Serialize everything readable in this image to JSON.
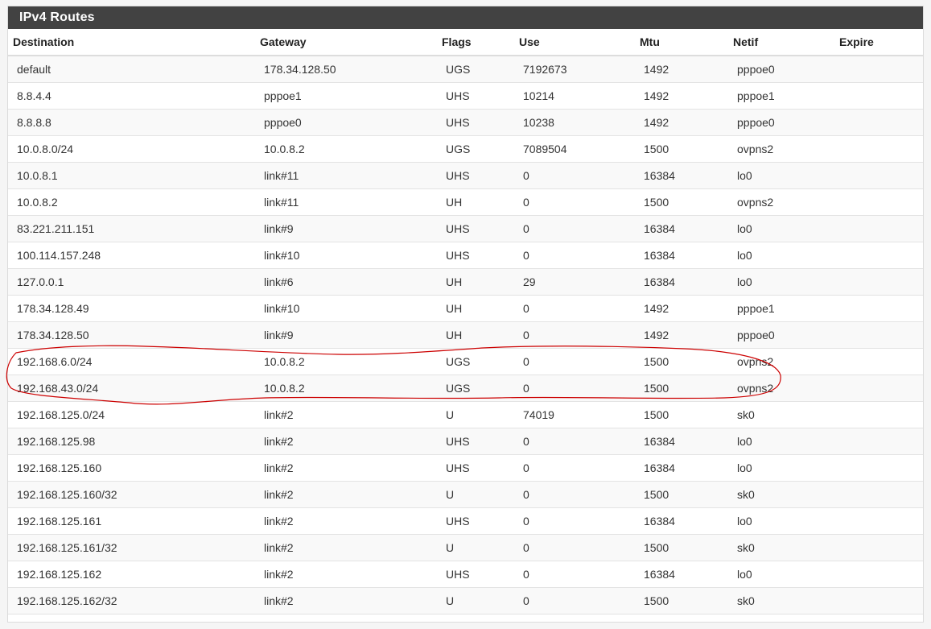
{
  "panel": {
    "title": "IPv4 Routes"
  },
  "table": {
    "headers": {
      "destination": "Destination",
      "gateway": "Gateway",
      "flags": "Flags",
      "use": "Use",
      "mtu": "Mtu",
      "netif": "Netif",
      "expire": "Expire"
    },
    "rows": [
      {
        "destination": "default",
        "gateway": "178.34.128.50",
        "flags": "UGS",
        "use": "7192673",
        "mtu": "1492",
        "netif": "pppoe0",
        "expire": ""
      },
      {
        "destination": "8.8.4.4",
        "gateway": "pppoe1",
        "flags": "UHS",
        "use": "10214",
        "mtu": "1492",
        "netif": "pppoe1",
        "expire": ""
      },
      {
        "destination": "8.8.8.8",
        "gateway": "pppoe0",
        "flags": "UHS",
        "use": "10238",
        "mtu": "1492",
        "netif": "pppoe0",
        "expire": ""
      },
      {
        "destination": "10.0.8.0/24",
        "gateway": "10.0.8.2",
        "flags": "UGS",
        "use": "7089504",
        "mtu": "1500",
        "netif": "ovpns2",
        "expire": ""
      },
      {
        "destination": "10.0.8.1",
        "gateway": "link#11",
        "flags": "UHS",
        "use": "0",
        "mtu": "16384",
        "netif": "lo0",
        "expire": ""
      },
      {
        "destination": "10.0.8.2",
        "gateway": "link#11",
        "flags": "UH",
        "use": "0",
        "mtu": "1500",
        "netif": "ovpns2",
        "expire": ""
      },
      {
        "destination": "83.221.211.151",
        "gateway": "link#9",
        "flags": "UHS",
        "use": "0",
        "mtu": "16384",
        "netif": "lo0",
        "expire": ""
      },
      {
        "destination": "100.114.157.248",
        "gateway": "link#10",
        "flags": "UHS",
        "use": "0",
        "mtu": "16384",
        "netif": "lo0",
        "expire": ""
      },
      {
        "destination": "127.0.0.1",
        "gateway": "link#6",
        "flags": "UH",
        "use": "29",
        "mtu": "16384",
        "netif": "lo0",
        "expire": ""
      },
      {
        "destination": "178.34.128.49",
        "gateway": "link#10",
        "flags": "UH",
        "use": "0",
        "mtu": "1492",
        "netif": "pppoe1",
        "expire": ""
      },
      {
        "destination": "178.34.128.50",
        "gateway": "link#9",
        "flags": "UH",
        "use": "0",
        "mtu": "1492",
        "netif": "pppoe0",
        "expire": ""
      },
      {
        "destination": "192.168.6.0/24",
        "gateway": "10.0.8.2",
        "flags": "UGS",
        "use": "0",
        "mtu": "1500",
        "netif": "ovpns2",
        "expire": ""
      },
      {
        "destination": "192.168.43.0/24",
        "gateway": "10.0.8.2",
        "flags": "UGS",
        "use": "0",
        "mtu": "1500",
        "netif": "ovpns2",
        "expire": ""
      },
      {
        "destination": "192.168.125.0/24",
        "gateway": "link#2",
        "flags": "U",
        "use": "74019",
        "mtu": "1500",
        "netif": "sk0",
        "expire": ""
      },
      {
        "destination": "192.168.125.98",
        "gateway": "link#2",
        "flags": "UHS",
        "use": "0",
        "mtu": "16384",
        "netif": "lo0",
        "expire": ""
      },
      {
        "destination": "192.168.125.160",
        "gateway": "link#2",
        "flags": "UHS",
        "use": "0",
        "mtu": "16384",
        "netif": "lo0",
        "expire": ""
      },
      {
        "destination": "192.168.125.160/32",
        "gateway": "link#2",
        "flags": "U",
        "use": "0",
        "mtu": "1500",
        "netif": "sk0",
        "expire": ""
      },
      {
        "destination": "192.168.125.161",
        "gateway": "link#2",
        "flags": "UHS",
        "use": "0",
        "mtu": "16384",
        "netif": "lo0",
        "expire": ""
      },
      {
        "destination": "192.168.125.161/32",
        "gateway": "link#2",
        "flags": "U",
        "use": "0",
        "mtu": "1500",
        "netif": "sk0",
        "expire": ""
      },
      {
        "destination": "192.168.125.162",
        "gateway": "link#2",
        "flags": "UHS",
        "use": "0",
        "mtu": "16384",
        "netif": "lo0",
        "expire": ""
      },
      {
        "destination": "192.168.125.162/32",
        "gateway": "link#2",
        "flags": "U",
        "use": "0",
        "mtu": "1500",
        "netif": "sk0",
        "expire": ""
      }
    ]
  },
  "colors": {
    "heading_bg": "#424242",
    "heading_text": "#ffffff",
    "annotation": "#cc0000"
  }
}
